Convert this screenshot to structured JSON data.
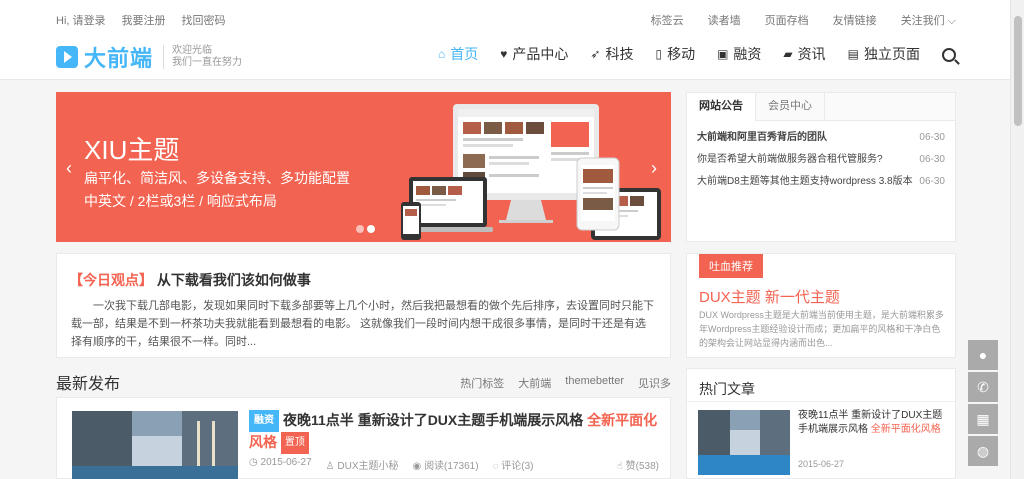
{
  "header": {
    "top_left": [
      "Hi, 请登录",
      "我要注册",
      "找回密码"
    ],
    "top_right": [
      "标签云",
      "读者墙",
      "页面存档",
      "友情链接",
      "关注我们 ⌵"
    ],
    "logo_text": "大前端",
    "slogan_1": "欢迎光临",
    "slogan_2": "我们一直在努力",
    "nav": [
      {
        "label": "首页",
        "icon": "home-icon",
        "glyph": "⌂"
      },
      {
        "label": "产品中心",
        "icon": "heart-icon",
        "glyph": "♥"
      },
      {
        "label": "科技",
        "icon": "rocket-icon",
        "glyph": "➶"
      },
      {
        "label": "移动",
        "icon": "mobile-icon",
        "glyph": "▯"
      },
      {
        "label": "融资",
        "icon": "money-icon",
        "glyph": "▣"
      },
      {
        "label": "资讯",
        "icon": "book-icon",
        "glyph": "▰"
      },
      {
        "label": "独立页面",
        "icon": "file-icon",
        "glyph": "▤"
      }
    ]
  },
  "banner": {
    "title": "XIU主题",
    "line1": "扁平化、简洁风、多设备支持、多功能配置",
    "line2": "中英文 / 2栏或3栏 / 响应式布局",
    "prev": "‹",
    "next": "›",
    "color": "#f36351"
  },
  "today": {
    "tag": "【今日观点】",
    "title": "从下载看我们该如何做事",
    "body": "一次我下载几部电影，发现如果同时下载多部要等上几个小时，然后我把最想看的做个先后排序，去设置同时只能下载一部，结果是不到一杯茶功夫我就能看到最想看的电影。 这就像我们一段时间内想干成很多事情，是同时干还是有选择有顺序的干，结果很不一样。同时..."
  },
  "latest": {
    "heading": "最新发布",
    "tags": [
      "热门标签",
      "大前端",
      "themebetter",
      "见识多"
    ],
    "post": {
      "badge": "融资",
      "title": "夜晚11点半 重新设计了DUX主题手机端展示风格",
      "highlight": "全新平面化风格",
      "rec": "置顶",
      "date": "2015-06-27",
      "author": "DUX主题小秘",
      "views": "阅读(17361)",
      "comments": "评论(3)",
      "likes": "赞(538)"
    }
  },
  "notice": {
    "tabs": [
      "网站公告",
      "会员中心"
    ],
    "items": [
      {
        "text": "大前端和阿里百秀背后的团队",
        "date": "06-30"
      },
      {
        "text": "你是否希望大前端做服务器合租代管服务?",
        "date": "06-30"
      },
      {
        "text": "大前端D8主题等其他主题支持wordpress 3.8版本",
        "date": "06-30"
      }
    ]
  },
  "recommend": {
    "badge": "吐血推荐",
    "title": "DUX主题 新一代主题",
    "desc": "DUX Wordpress主题是大前端当前使用主题，是大前端积累多年Wordpress主题经验设计而成；更加扁平的风格和干净白色的架构会让网站显得内涵而出色..."
  },
  "hot": {
    "heading": "热门文章",
    "title": "夜晚11点半 重新设计了DUX主题手机端展示风格",
    "highlight": "全新平面化风格",
    "date": "2015-06-27"
  },
  "accent": "#45b6f7"
}
